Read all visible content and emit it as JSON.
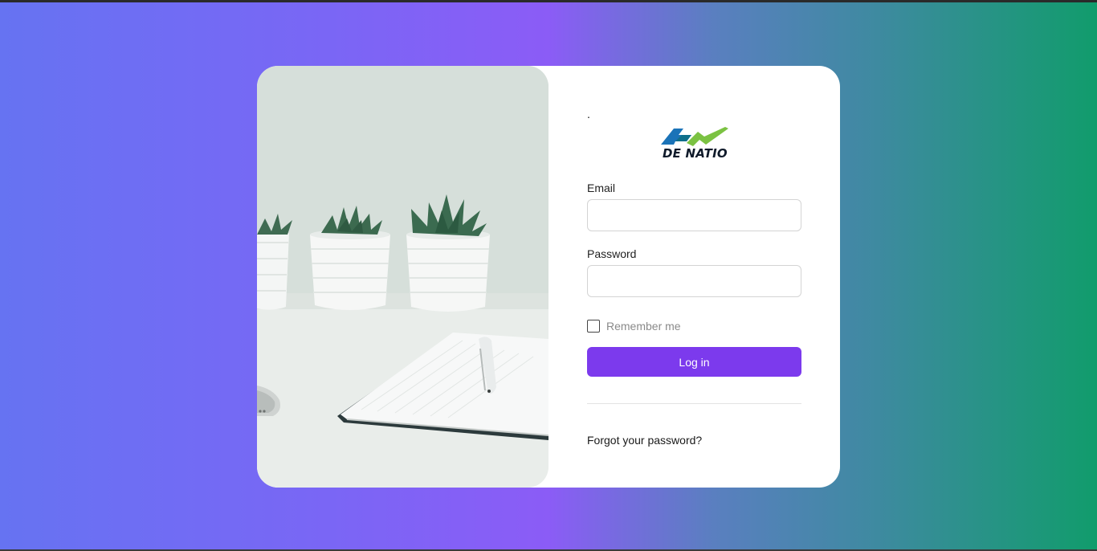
{
  "brand": {
    "dot": ".",
    "logo_text": "DE NATIO",
    "logo_colors": {
      "blue": "#1a73b8",
      "teal": "#0f6f8a",
      "green": "#7bc242"
    }
  },
  "form": {
    "email_label": "Email",
    "email_value": "",
    "password_label": "Password",
    "password_value": "",
    "remember_label": "Remember me",
    "remember_checked": false,
    "login_label": "Log in",
    "forgot_label": "Forgot your password?"
  },
  "theme": {
    "accent": "#7c3aed",
    "gradient_left": "#6673f2",
    "gradient_mid": "#8b5cf6",
    "gradient_right": "#119c6c"
  }
}
